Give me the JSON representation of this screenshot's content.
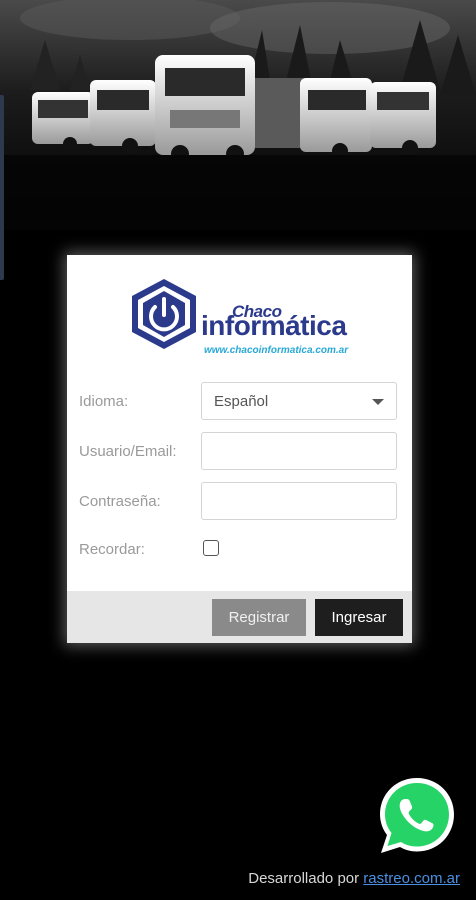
{
  "brand": {
    "name_small": "Chaco",
    "name_big": "informática",
    "url": "www.chacoinformatica.com.ar",
    "colors": {
      "primary": "#2c3a8c",
      "accent": "#28a9d6"
    }
  },
  "hero": {
    "icon": "truck-fleet-image"
  },
  "form": {
    "language_label": "Idioma:",
    "language_value": "Español",
    "user_label": "Usuario/Email:",
    "user_value": "",
    "password_label": "Contraseña:",
    "password_value": "",
    "remember_label": "Recordar:",
    "remember_checked": false
  },
  "actions": {
    "register_label": "Registrar",
    "login_label": "Ingresar"
  },
  "footer": {
    "credit_prefix": "Desarrollado por ",
    "credit_link": "rastreo.com.ar"
  },
  "whatsapp": {
    "icon": "whatsapp-icon",
    "color": "#25d366"
  }
}
